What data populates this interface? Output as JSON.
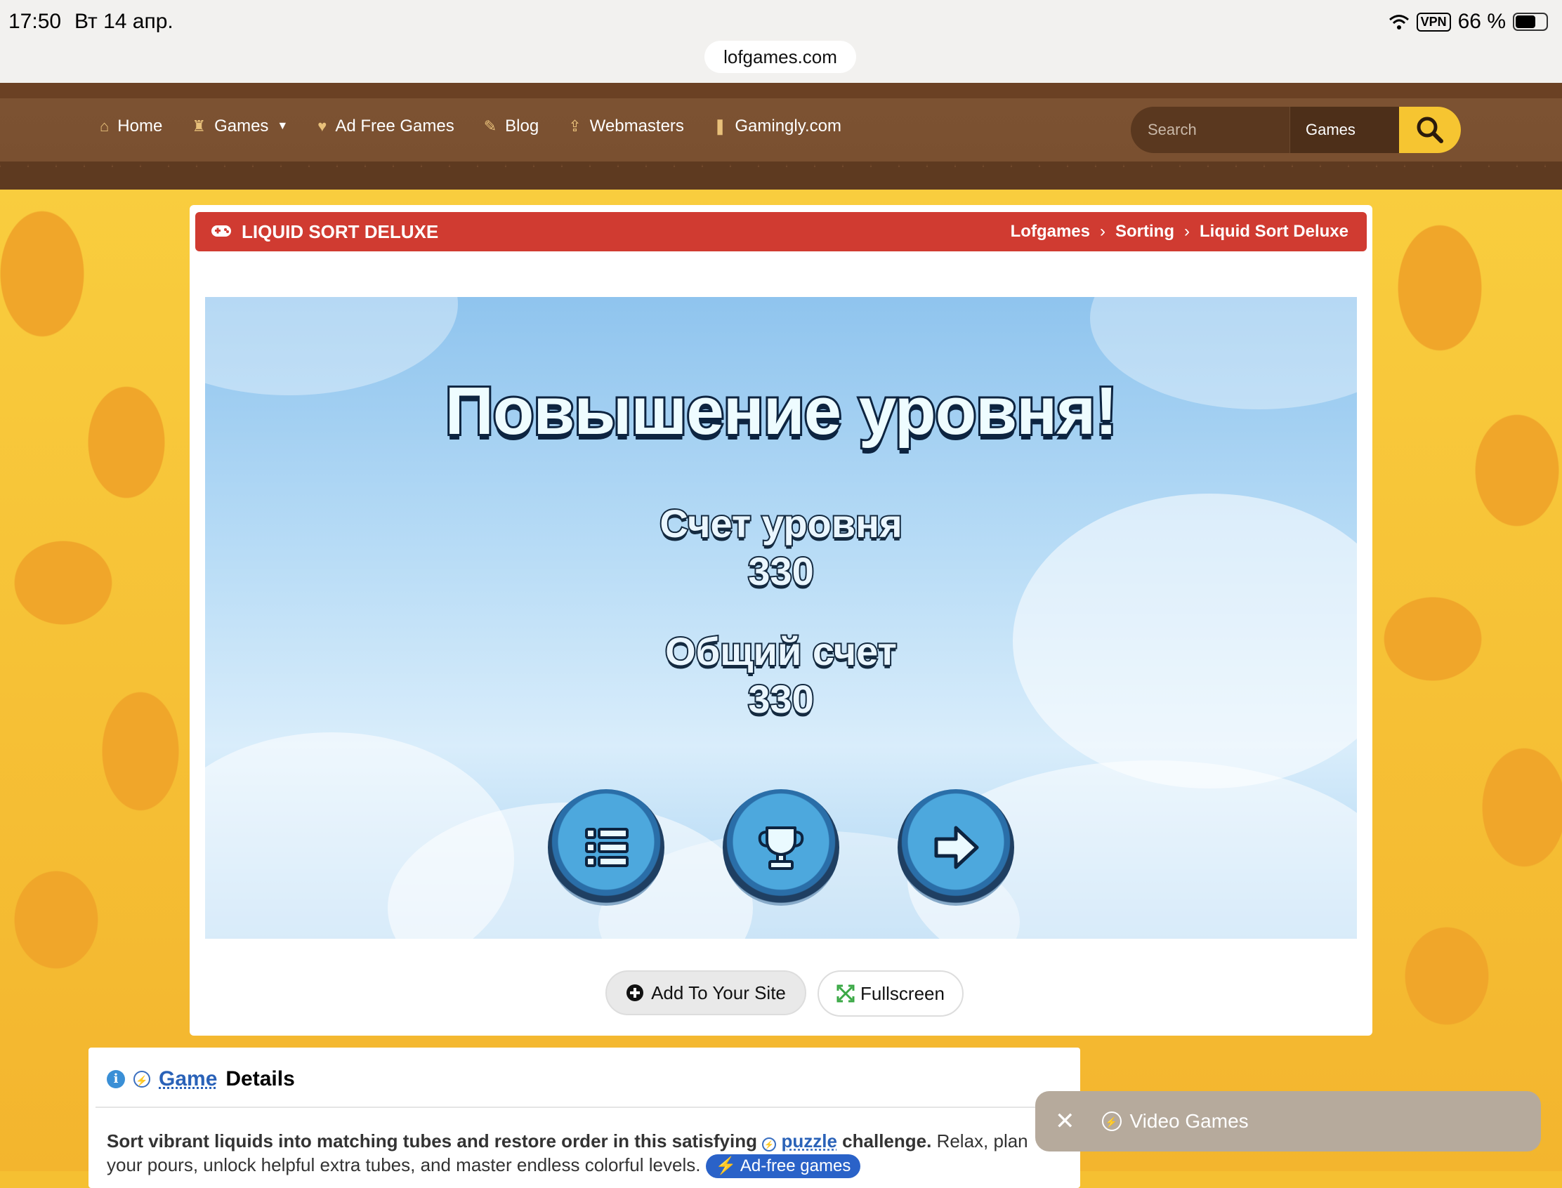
{
  "status_bar": {
    "time": "17:50",
    "date": "Вт 14 апр.",
    "vpn": "VPN",
    "battery": "66 %"
  },
  "browser": {
    "url": "lofgames.com"
  },
  "nav": {
    "items": [
      {
        "label": "Home",
        "icon": "home-icon"
      },
      {
        "label": "Games",
        "icon": "castle-icon"
      },
      {
        "label": "Ad Free Games",
        "icon": "heart-icon"
      },
      {
        "label": "Blog",
        "icon": "pencil-icon"
      },
      {
        "label": "Webmasters",
        "icon": "upload-icon"
      },
      {
        "label": "Gamingly.com",
        "icon": "bookmark-icon"
      }
    ],
    "search_placeholder": "Search",
    "search_category": "Games"
  },
  "game_page": {
    "title": "LIQUID SORT DELUXE",
    "breadcrumbs": [
      "Lofgames",
      "Sorting",
      "Liquid Sort Deluxe"
    ]
  },
  "game_screen": {
    "heading": "Повышение уровня!",
    "level_score_label": "Счет уровня",
    "level_score_value": "330",
    "total_score_label": "Общий счет",
    "total_score_value": "330"
  },
  "actions": {
    "add_to_site": "Add To Your Site",
    "fullscreen": "Fullscreen"
  },
  "details": {
    "heading_link": "Game",
    "heading_rest": "Details",
    "text_bold_1": "Sort vibrant liquids into matching tubes and restore order in this satisfying",
    "puzzle_link": "puzzle",
    "text_bold_2": "challenge.",
    "text_1": "Relax, plan",
    "text_2": "your pours, unlock helpful extra tubes, and master endless colorful levels.",
    "badge": "Ad-free games"
  },
  "toast": {
    "label": "Video Games"
  },
  "colors": {
    "accent_red": "#d03b31",
    "nav_brown": "#7a5030",
    "search_yellow": "#f6c531"
  }
}
